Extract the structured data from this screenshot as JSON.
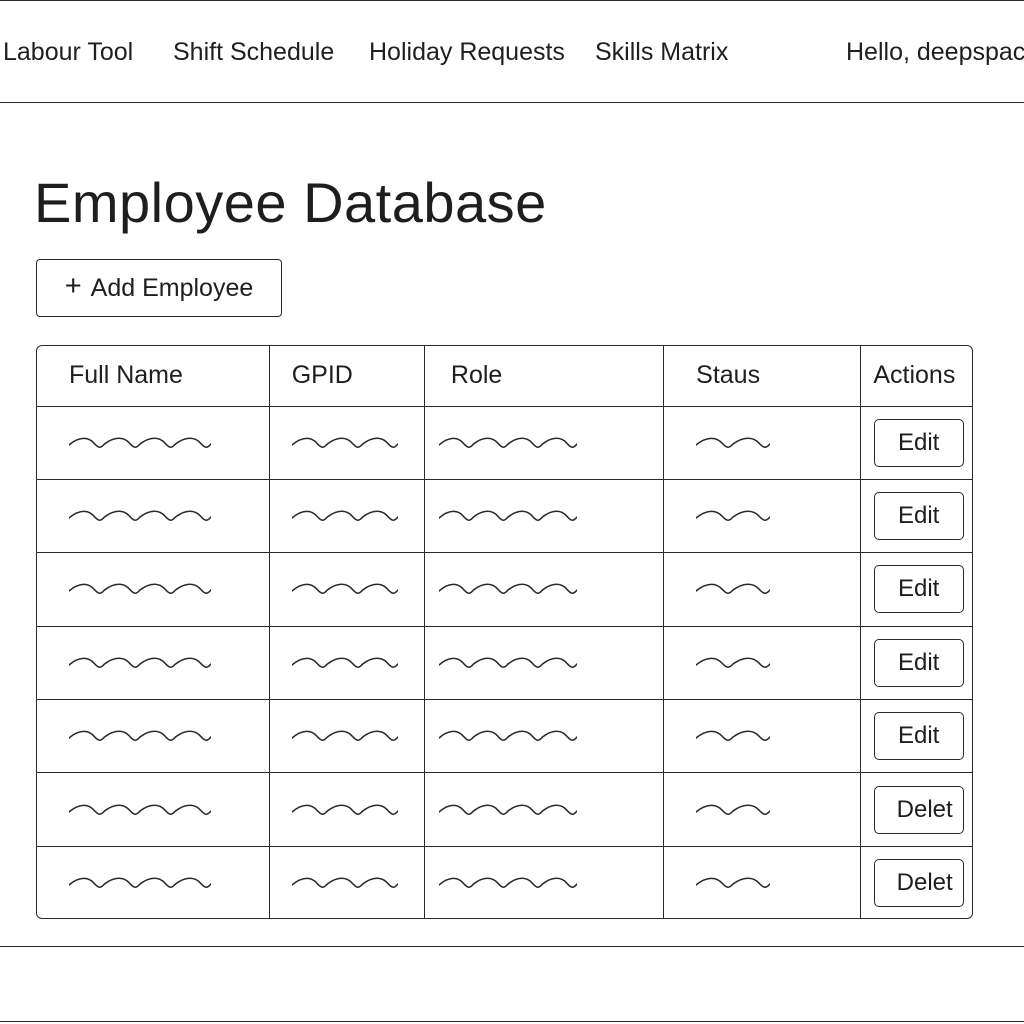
{
  "nav": {
    "brand": "Labour Tool",
    "links": [
      "Shift Schedule",
      "Holiday Requests",
      "Skills Matrix"
    ],
    "greeting": "Hello, deepspac"
  },
  "page": {
    "title": "Employee Database"
  },
  "toolbar": {
    "add_icon": "plus-icon",
    "add_label": "Add Employee"
  },
  "table": {
    "columns": [
      "Full Name",
      "GPID",
      "Role",
      "Staus",
      "Actions"
    ],
    "rows": [
      {
        "action": "Edit"
      },
      {
        "action": "Edit"
      },
      {
        "action": "Edit"
      },
      {
        "action": "Edit"
      },
      {
        "action": "Edit"
      },
      {
        "action": "Delet"
      },
      {
        "action": "Delet"
      }
    ]
  }
}
